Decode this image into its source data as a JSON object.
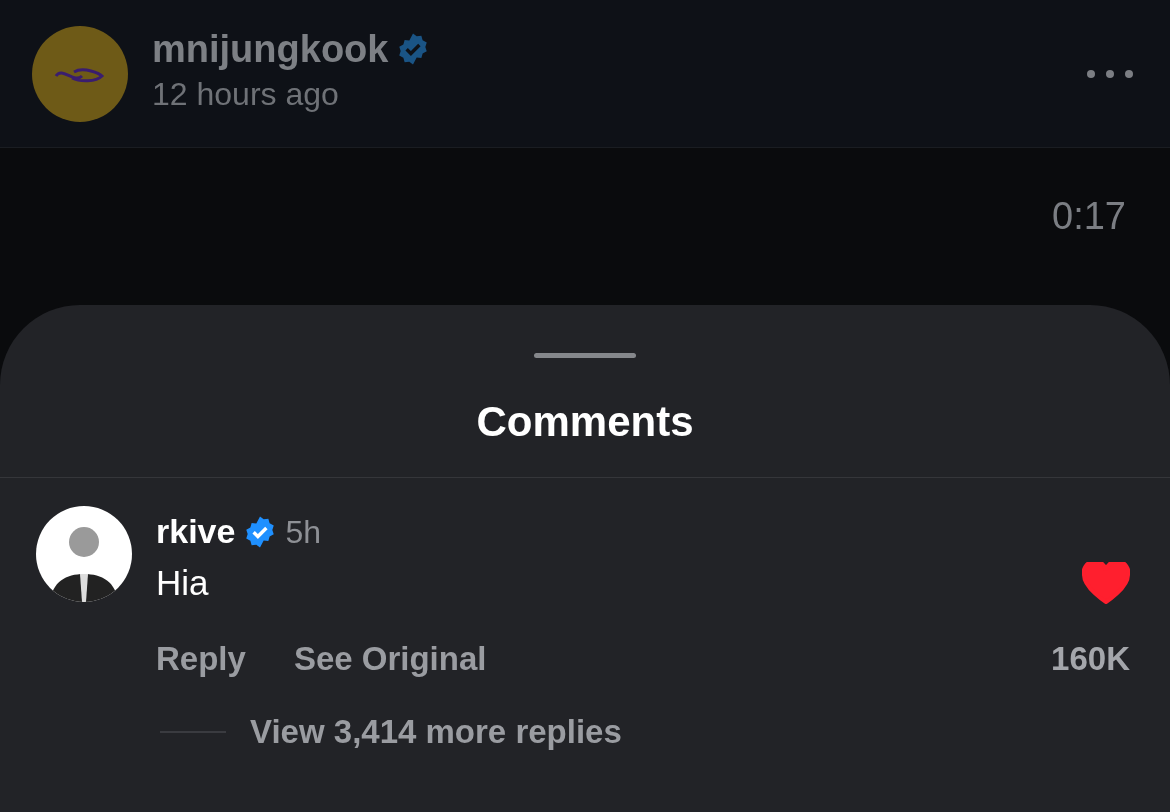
{
  "post": {
    "author": "mnijungkook",
    "verified": true,
    "time": "12 hours ago",
    "video_time": "0:17"
  },
  "sheet": {
    "title": "Comments"
  },
  "comments": [
    {
      "author": "rkive",
      "verified": true,
      "time": "5h",
      "text": "Hia",
      "liked": true,
      "like_count": "160K",
      "actions": [
        "Reply",
        "See Original"
      ],
      "view_replies": "View 3,414 more replies"
    }
  ]
}
